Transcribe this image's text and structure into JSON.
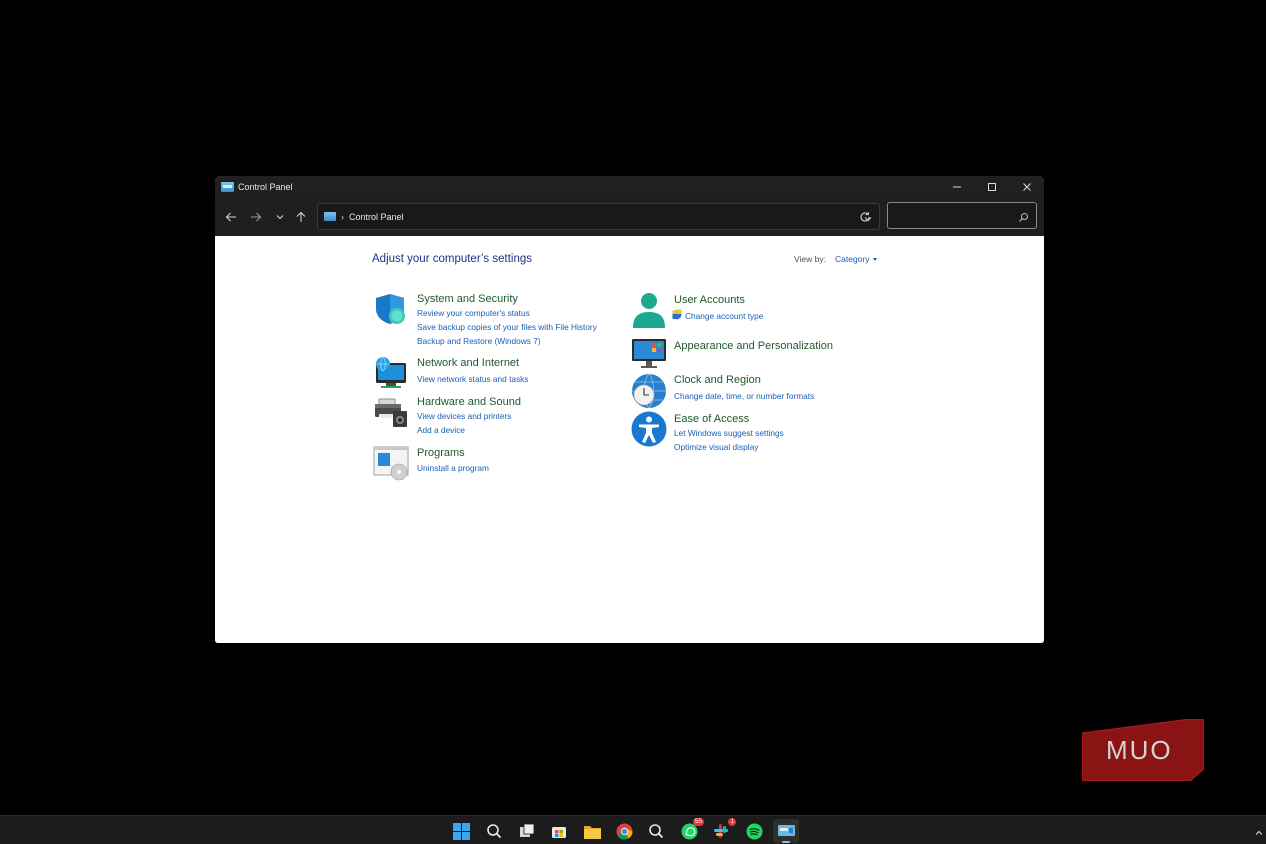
{
  "window": {
    "title": "Control Panel",
    "minimize_label": "—",
    "maximize_label": "☐",
    "close_label": "✕"
  },
  "address": {
    "path": "Control Panel",
    "separator": "›"
  },
  "search": {
    "placeholder": ""
  },
  "content": {
    "heading": "Adjust your computer’s settings",
    "view_by_label": "View by:",
    "view_by_value": "Category"
  },
  "categories": {
    "system_security": {
      "title": "System and Security",
      "links": [
        "Review your computer's status",
        "Save backup copies of your files with File History",
        "Backup and Restore (Windows 7)"
      ]
    },
    "network": {
      "title": "Network and Internet",
      "links": [
        "View network status and tasks"
      ]
    },
    "hardware": {
      "title": "Hardware and Sound",
      "links": [
        "View devices and printers",
        "Add a device"
      ]
    },
    "programs": {
      "title": "Programs",
      "links": [
        "Uninstall a program"
      ]
    },
    "user_accounts": {
      "title": "User Accounts",
      "links": [
        "Change account type"
      ]
    },
    "appearance": {
      "title": "Appearance and Personalization",
      "links": []
    },
    "clock": {
      "title": "Clock and Region",
      "links": [
        "Change date, time, or number formats"
      ]
    },
    "ease": {
      "title": "Ease of Access",
      "links": [
        "Let Windows suggest settings",
        "Optimize visual display"
      ]
    }
  },
  "taskbar": {
    "whatsapp_badge": "55",
    "app_badge": "1"
  },
  "watermark": {
    "text": "MUO"
  },
  "colors": {
    "accent_link": "#1a5fb4",
    "category_title": "#1e5a2e",
    "heading": "#1e3287",
    "titlebar": "#202020"
  }
}
